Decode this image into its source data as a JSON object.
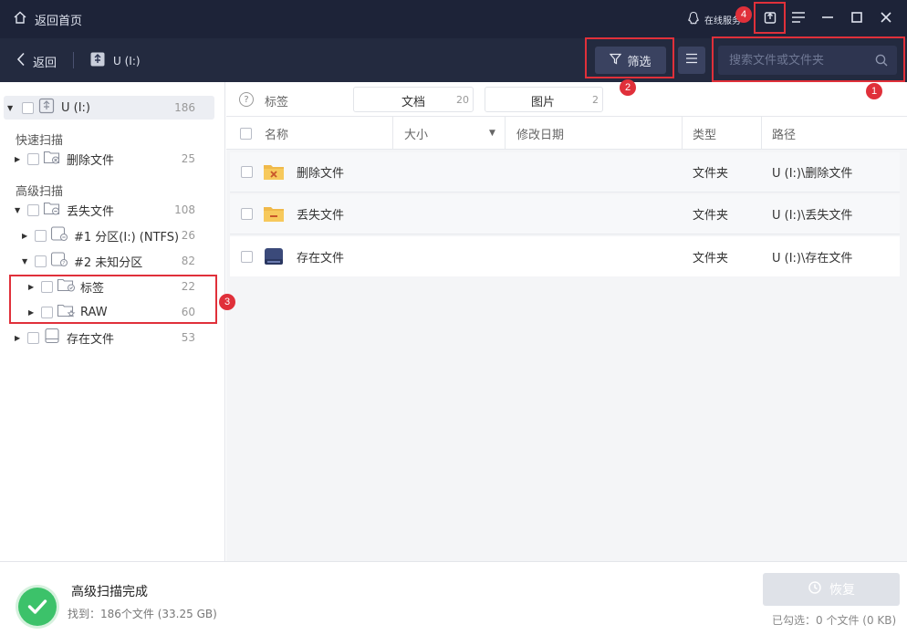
{
  "titlebar": {
    "home_label": "返回首页",
    "online_label": "在线服务"
  },
  "toolbar": {
    "back_label": "返回",
    "drive_label": "U (I:)",
    "filter_label": "筛选",
    "search_placeholder": "搜索文件或文件夹"
  },
  "badges": {
    "b1": "1",
    "b2": "2",
    "b3": "3",
    "b4": "4"
  },
  "sidebar": {
    "root": {
      "label": "U (I:)",
      "count": "186"
    },
    "quick_scan_label": "快速扫描",
    "deleted": {
      "label": "删除文件",
      "count": "25"
    },
    "advanced_scan_label": "高级扫描",
    "lost": {
      "label": "丢失文件",
      "count": "108"
    },
    "partition1": {
      "label": "#1 分区(I:) (NTFS)",
      "count": "26"
    },
    "partition2": {
      "label": "#2 未知分区",
      "count": "82"
    },
    "tags": {
      "label": "标签",
      "count": "22"
    },
    "raw": {
      "label": "RAW",
      "count": "60"
    },
    "existing": {
      "label": "存在文件",
      "count": "53"
    }
  },
  "tagbar": {
    "help": "?",
    "label": "标签",
    "chips": [
      {
        "name": "文档",
        "count": "20"
      },
      {
        "name": "图片",
        "count": "2"
      }
    ]
  },
  "table": {
    "headers": {
      "name": "名称",
      "size": "大小",
      "modified": "修改日期",
      "type": "类型",
      "path": "路径"
    },
    "rows": [
      {
        "name": "删除文件",
        "type": "文件夹",
        "path": "U (I:)\\删除文件"
      },
      {
        "name": "丢失文件",
        "type": "文件夹",
        "path": "U (I:)\\丢失文件"
      },
      {
        "name": "存在文件",
        "type": "文件夹",
        "path": "U (I:)\\存在文件"
      }
    ]
  },
  "status": {
    "title": "高级扫描完成",
    "found": "找到：186个文件 (33.25 GB)",
    "recover_label": "恢复",
    "selected": "已勾选：0 个文件 (0 KB)"
  },
  "colors": {
    "accent_red": "#e0303a",
    "success_green": "#3cc26a",
    "header_dark": "#1d2338"
  },
  "icons": [
    "home-icon",
    "qq-icon",
    "export-icon",
    "hamburger-icon",
    "minimize-icon",
    "maximize-icon",
    "close-icon",
    "chevron-left-icon",
    "usb-drive-icon",
    "funnel-icon",
    "list-icon",
    "search-icon",
    "folder-icon",
    "check-icon",
    "history-icon"
  ]
}
